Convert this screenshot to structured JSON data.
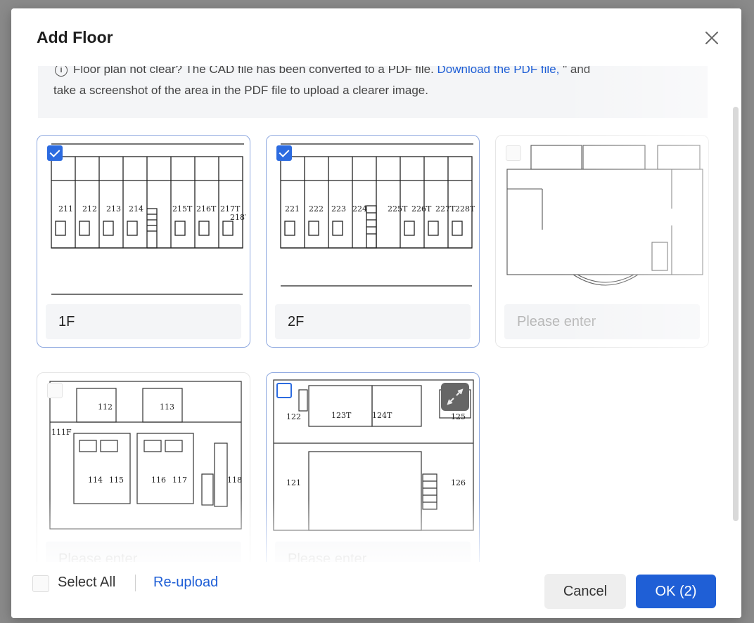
{
  "dialog": {
    "title": "Add Floor",
    "close_icon": "close-icon"
  },
  "notice": {
    "icon": "info-icon",
    "text_before_link": "Floor plan not clear? The CAD file has been converted to a PDF file.",
    "link": "Download the PDF file,",
    "text_after_link": "\" and",
    "line2": "take a screenshot of the area in the PDF file to upload a clearer image."
  },
  "floors": [
    {
      "value": "1F",
      "placeholder": "Please enter",
      "checked": true
    },
    {
      "value": "2F",
      "placeholder": "Please enter",
      "checked": true
    },
    {
      "value": "",
      "placeholder": "Please enter",
      "checked": false
    },
    {
      "value": "",
      "placeholder": "Please enter",
      "checked": false
    },
    {
      "value": "",
      "placeholder": "Please enter",
      "checked": false
    }
  ],
  "plan_labels": {
    "floor1_rooms": [
      "211",
      "212",
      "213",
      "214",
      "215T",
      "216T",
      "217T",
      "218T"
    ],
    "floor2_rooms": [
      "221",
      "222",
      "223",
      "224",
      "225T",
      "226T",
      "227T",
      "228T"
    ],
    "floor4_rooms": [
      "112",
      "113",
      "111F",
      "114",
      "115",
      "116",
      "117",
      "118"
    ],
    "floor5_rooms": [
      "122",
      "123T",
      "124T",
      "125",
      "121",
      "126"
    ]
  },
  "footer": {
    "select_all_label": "Select All",
    "reupload_label": "Re-upload",
    "cancel_label": "Cancel",
    "ok_label": "OK (2)"
  },
  "colors": {
    "primary": "#1f5fd6",
    "checkbox": "#2c6be0",
    "card_border_selected": "#8fa9e0"
  }
}
